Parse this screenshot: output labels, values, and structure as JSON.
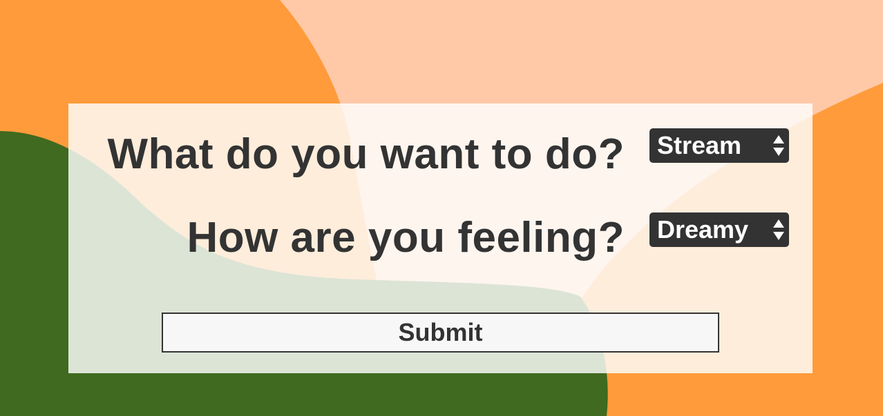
{
  "form": {
    "activity_question": "What do you want to do?",
    "activity_selected": "Stream",
    "mood_question": "How are you feeling?",
    "mood_selected": "Dreamy",
    "submit_label": "Submit"
  },
  "colors": {
    "orange": "#FF9B3B",
    "peach": "#FFC9A8",
    "green": "#3F6A1F",
    "text": "#333333",
    "select_bg": "#333333",
    "button_bg": "#F7F7F7"
  },
  "icons": {
    "select_arrows": "up-down-caret-icon"
  }
}
